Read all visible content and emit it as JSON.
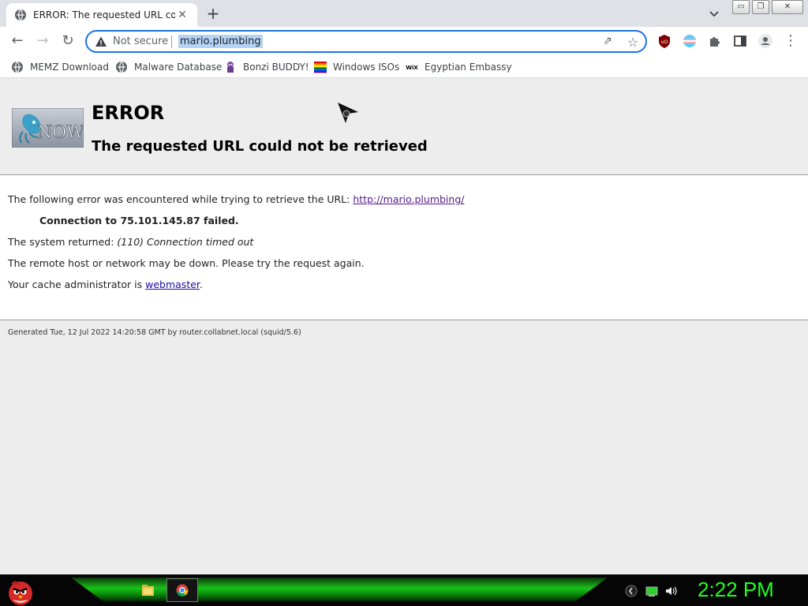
{
  "browser": {
    "tab": {
      "title": "ERROR: The requested URL could not be retrieved",
      "close": "✕"
    },
    "new_tab": "+",
    "window_controls": {
      "minimize": "▭",
      "restore": "❐",
      "close": "✕"
    },
    "nav": {
      "back": "←",
      "forward": "→",
      "reload": "↻"
    },
    "omnibox": {
      "security": "Not secure",
      "url": "mario.plumbing",
      "share": "⇗",
      "star": "☆"
    },
    "extensions": [
      "ublock-icon",
      "trans-flag-icon",
      "puzzle-icon",
      "sidepanel-icon",
      "profile-icon",
      "menu-icon"
    ],
    "menu": "⋮",
    "bookmarks": [
      {
        "label": "MEMZ Download",
        "icon": "globe-icon"
      },
      {
        "label": "Malware Database",
        "icon": "globe-icon"
      },
      {
        "label": "Bonzi BUDDY!",
        "icon": "bonzi-icon"
      },
      {
        "label": "Windows ISOs",
        "icon": "windows-flag-icon"
      },
      {
        "label": "Egyptian Embassy",
        "icon": "wix-icon"
      }
    ]
  },
  "page": {
    "logo_text": "NOW",
    "heading": "ERROR",
    "subheading": "The requested URL could not be retrieved",
    "line1_text": "The following error was encountered while trying to retrieve the URL: ",
    "line1_link": "http://mario.plumbing/",
    "line2": "Connection to 75.101.145.87 failed.",
    "line3_prefix": "The system returned: ",
    "line3_em": "(110) Connection timed out",
    "line4": "The remote host or network may be down. Please try the request again.",
    "line5_prefix": "Your cache administrator is ",
    "line5_link": "webmaster",
    "line5_suffix": ".",
    "footer": "Generated Tue, 12 Jul 2022 14:20:58 GMT by router.collabnet.local (squid/5.6)"
  },
  "taskbar": {
    "clock": "2:22 PM",
    "clock_color": "#20ff20"
  }
}
